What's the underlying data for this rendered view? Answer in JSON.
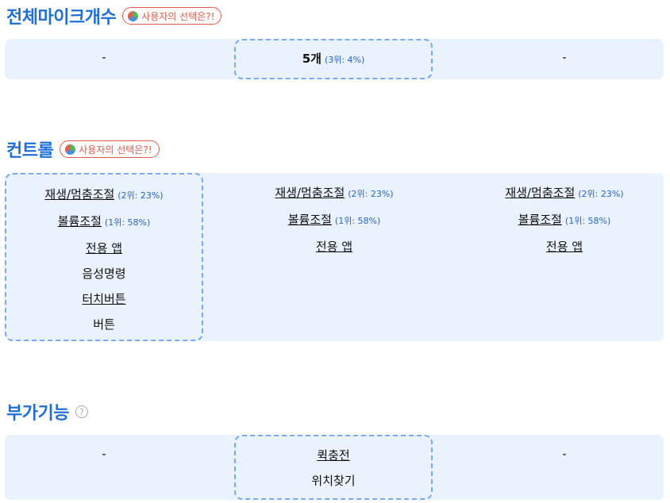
{
  "sections": {
    "mic": {
      "title": "전체마이크개수",
      "pill": "사용자의 선택은?!",
      "cols": [
        {
          "text": "-"
        },
        {
          "text": "5개",
          "rank": "(3위: 4%)"
        },
        {
          "text": "-"
        }
      ]
    },
    "control": {
      "title": "컨트롤",
      "pill": "사용자의 선택은?!",
      "col1": [
        {
          "text": "재생/멈춤조절",
          "rank": "(2위: 23%)"
        },
        {
          "text": "볼륨조절",
          "rank": "(1위: 58%)"
        },
        {
          "text": "전용 앱"
        },
        {
          "text": "음성명령"
        },
        {
          "text": "터치버튼"
        },
        {
          "text": "버튼"
        }
      ],
      "col2": [
        {
          "text": "재생/멈춤조절",
          "rank": "(2위: 23%)"
        },
        {
          "text": "볼륨조절",
          "rank": "(1위: 58%)"
        },
        {
          "text": "전용 앱"
        }
      ],
      "col3": [
        {
          "text": "재생/멈춤조절",
          "rank": "(2위: 23%)"
        },
        {
          "text": "볼륨조절",
          "rank": "(1위: 58%)"
        },
        {
          "text": "전용 앱"
        }
      ]
    },
    "extra": {
      "title": "부가기능",
      "help_icon": "?",
      "cols": [
        {
          "text": "-"
        },
        {
          "items": [
            "퀵충전",
            "위치찾기"
          ]
        },
        {
          "text": "-"
        }
      ]
    }
  }
}
